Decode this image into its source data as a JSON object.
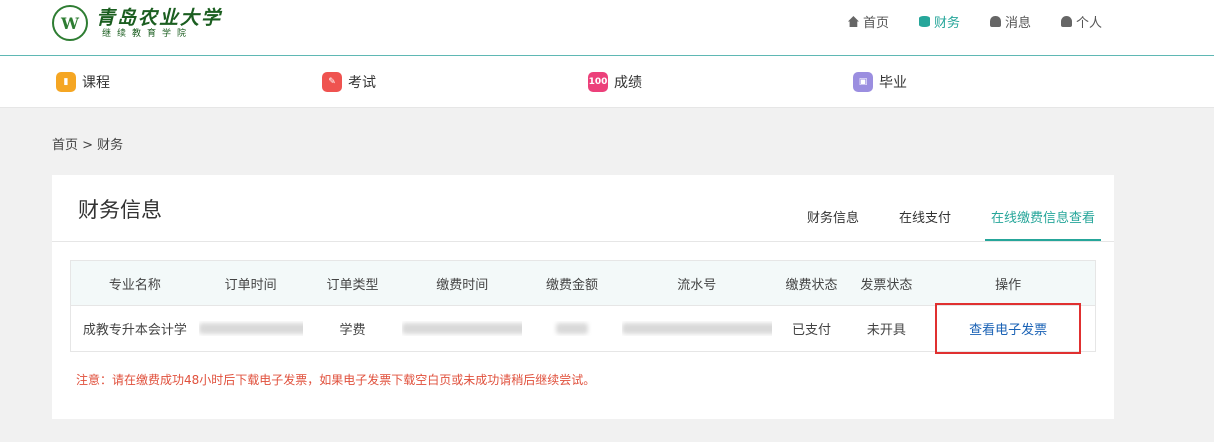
{
  "header": {
    "logo": {
      "seal": "W",
      "title": "青岛农业大学",
      "subtitle": "继续教育学院"
    },
    "nav": [
      {
        "icon": "home-icon",
        "label": "首页"
      },
      {
        "icon": "database-icon",
        "label": "财务",
        "active": true
      },
      {
        "icon": "bell-icon",
        "label": "消息"
      },
      {
        "icon": "user-icon",
        "label": "个人"
      }
    ]
  },
  "subnav": [
    {
      "icon": "bookmark-icon",
      "label": "课程",
      "color": "#f5a623"
    },
    {
      "icon": "pencil-icon",
      "label": "考试",
      "color": "#ef5350"
    },
    {
      "icon": "score-icon",
      "label": "成绩",
      "color": "#ec407a",
      "glyph": "100"
    },
    {
      "icon": "graduation-icon",
      "label": "毕业",
      "color": "#9b8ee0"
    }
  ],
  "breadcrumb": "首页 > 财务",
  "panel": {
    "title": "财务信息",
    "tabs": [
      "财务信息",
      "在线支付",
      "在线缴费信息查看"
    ],
    "active_tab": 2
  },
  "table": {
    "headers": [
      "专业名称",
      "订单时间",
      "订单类型",
      "缴费时间",
      "缴费金额",
      "流水号",
      "缴费状态",
      "发票状态",
      "操作"
    ],
    "rows": [
      {
        "major": "成教专升本会计学",
        "order_type": "学费",
        "pay_status": "已支付",
        "invoice_status": "未开具",
        "action": "查看电子发票"
      }
    ]
  },
  "note": "注意：请在缴费成功48小时后下载电子发票，如果电子发票下载空白页或未成功请稍后继续尝试。",
  "colors": {
    "accent": "#26a69a",
    "link": "#1a62b5",
    "warning": "#e0503c",
    "highlight_box": "#e03030"
  }
}
